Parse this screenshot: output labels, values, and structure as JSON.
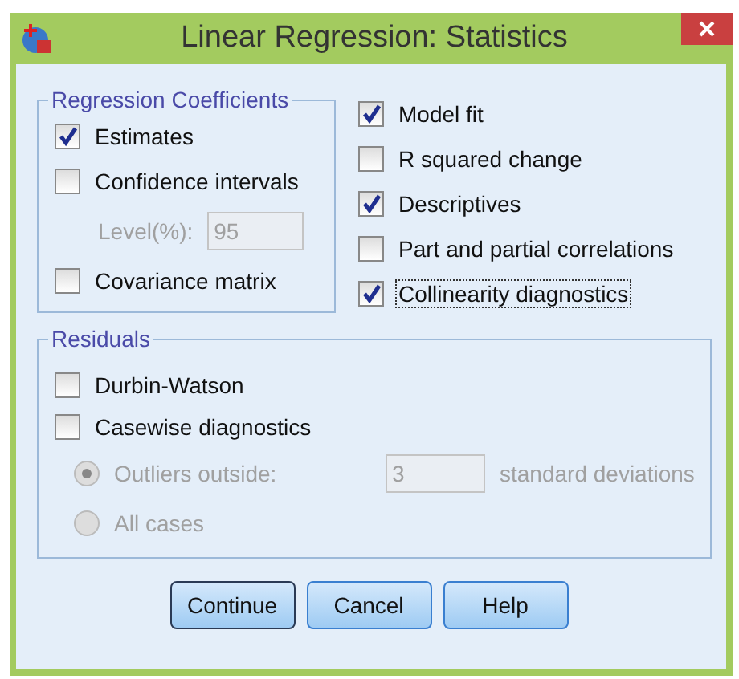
{
  "window": {
    "title": "Linear Regression: Statistics"
  },
  "regression_coefficients": {
    "title": "Regression Coefficients",
    "items": [
      {
        "kind": "checkbox",
        "label": "Estimates",
        "checked": true
      },
      {
        "kind": "checkbox",
        "label": "Confidence intervals",
        "checked": false
      },
      {
        "kind": "field",
        "label": "Level(%):",
        "value": "95",
        "disabled": true
      },
      {
        "kind": "checkbox",
        "label": "Covariance matrix",
        "checked": false
      }
    ]
  },
  "options": [
    {
      "label": "Model fit",
      "checked": true,
      "focused": false
    },
    {
      "label": "R squared change",
      "checked": false,
      "focused": false
    },
    {
      "label": "Descriptives",
      "checked": true,
      "focused": false
    },
    {
      "label": "Part and partial correlations",
      "checked": false,
      "focused": false
    },
    {
      "label": "Collinearity diagnostics",
      "checked": true,
      "focused": true
    }
  ],
  "residuals": {
    "title": "Residuals",
    "items": [
      {
        "kind": "checkbox",
        "label": "Durbin-Watson",
        "checked": false
      },
      {
        "kind": "checkbox",
        "label": "Casewise diagnostics",
        "checked": false
      },
      {
        "kind": "radio",
        "label": "Outliers outside:",
        "selected": true,
        "disabled": true,
        "value": "3",
        "suffix": "standard deviations"
      },
      {
        "kind": "radio",
        "label": "All cases",
        "selected": false,
        "disabled": true
      }
    ]
  },
  "buttons": [
    {
      "label": "Continue",
      "default": true
    },
    {
      "label": "Cancel",
      "default": false
    },
    {
      "label": "Help",
      "default": false
    }
  ]
}
